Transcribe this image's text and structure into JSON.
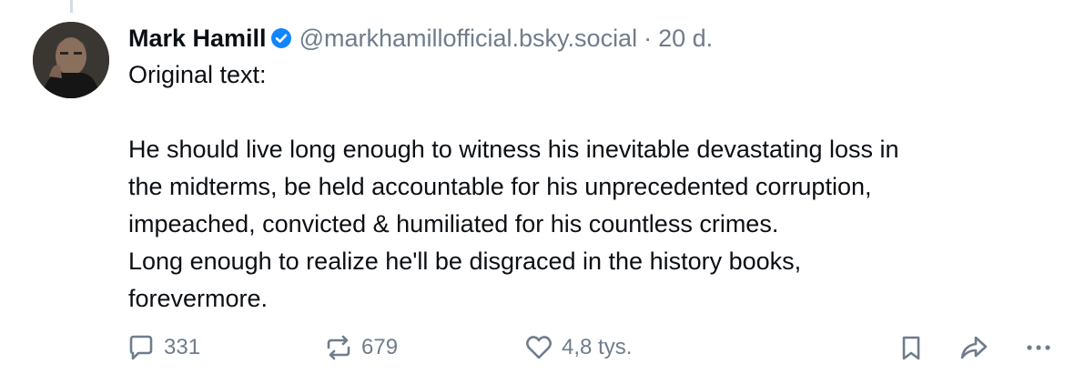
{
  "post": {
    "author_name": "Mark Hamill",
    "handle": "@markhamillofficial.bsky.social",
    "separator": "·",
    "timestamp": "20 d.",
    "text": "Original text:\n\nHe should live long enough to witness his inevitable devastating loss in\nthe midterms, be held accountable for his unprecedented corruption,\nimpeached, convicted & humiliated for his countless crimes.\nLong enough to realize he'll be disgraced in the history books,\nforevermore."
  },
  "actions": {
    "replies": "331",
    "reposts": "679",
    "likes": "4,8 tys."
  },
  "icons": {
    "verified": "verified-badge-icon",
    "reply": "speech-bubble-icon",
    "repost": "repost-arrows-icon",
    "like": "heart-icon",
    "bookmark": "bookmark-icon",
    "share": "share-arrow-icon",
    "more": "more-dots-icon"
  },
  "colors": {
    "verified": "#1185fe",
    "muted": "#6f7c8c",
    "text": "#0b0f14"
  }
}
